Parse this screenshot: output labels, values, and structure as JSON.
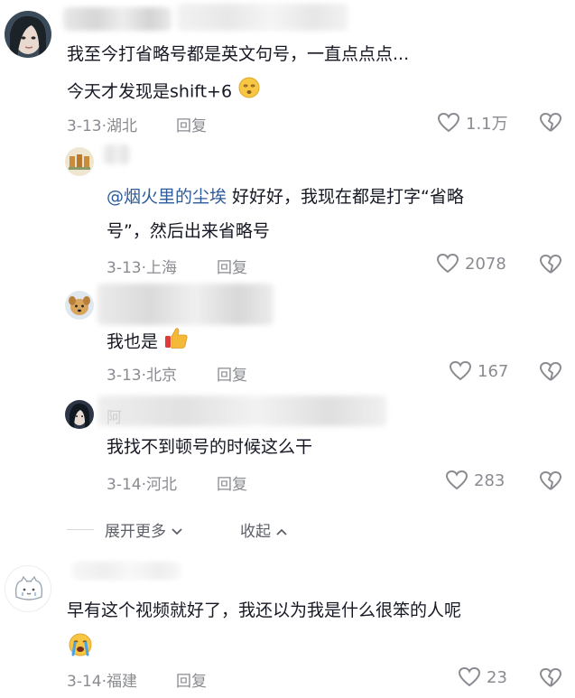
{
  "comments": [
    {
      "text_line1": "我至今打省略号都是英文句号，一直点点点...",
      "text_line2": "今天才发现是shift+6",
      "date": "3-13",
      "location": "湖北",
      "reply_label": "回复",
      "likes": "1.1万"
    },
    {
      "mention": "@烟火里的尘埃",
      "text_line1": " 好好好，我现在都是打字“省略",
      "text_line2": "号”，然后出来省略号",
      "date": "3-13",
      "location": "上海",
      "reply_label": "回复",
      "likes": "2078"
    },
    {
      "text_line1": "我也是",
      "date": "3-13",
      "location": "北京",
      "reply_label": "回复",
      "likes": "167"
    },
    {
      "text_line1": "我找不到顿号的时候这么干",
      "date": "3-14",
      "location": "河北",
      "reply_label": "回复",
      "likes": "283"
    },
    {
      "text_line1": "早有这个视频就好了，我还以为我是什么很笨的人呢",
      "date": "3-14",
      "location": "福建",
      "reply_label": "回复",
      "likes": "23"
    }
  ],
  "partial_name_glyph": "阿",
  "expand": {
    "more_label": "展开更多",
    "collapse_label": "收起"
  },
  "colors": {
    "text": "#161823",
    "meta": "#8a8b91",
    "mention": "#2c5b9b"
  },
  "icons": [
    "heart-outline-icon",
    "broken-heart-icon",
    "chevron-down-icon",
    "chevron-up-icon",
    "dizzy-face-emoji",
    "thumbs-up-emoji",
    "crying-face-emoji"
  ]
}
